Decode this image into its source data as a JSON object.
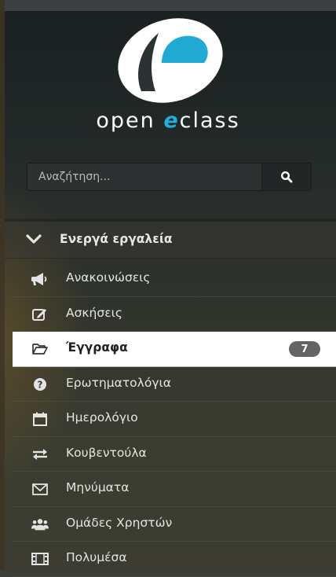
{
  "brand": {
    "open": "open ",
    "e": "e",
    "class": "class"
  },
  "search": {
    "placeholder": "Αναζήτηση..."
  },
  "section": {
    "title": "Ενεργά εργαλεία"
  },
  "menu": {
    "items": [
      {
        "label": "Ανακοινώσεις",
        "icon": "bullhorn-icon"
      },
      {
        "label": "Ασκήσεις",
        "icon": "edit-icon"
      },
      {
        "label": "Έγγραφα",
        "icon": "folder-open-icon",
        "badge": "7",
        "active": true
      },
      {
        "label": "Ερωτηματολόγια",
        "icon": "question-circle-icon"
      },
      {
        "label": "Ημερολόγιο",
        "icon": "calendar-icon"
      },
      {
        "label": "Κουβεντούλα",
        "icon": "exchange-icon"
      },
      {
        "label": "Μηνύματα",
        "icon": "envelope-icon"
      },
      {
        "label": "Ομάδες Χρηστών",
        "icon": "users-icon"
      },
      {
        "label": "Πολυμέσα",
        "icon": "film-icon"
      }
    ]
  },
  "colors": {
    "accent": "#1fb0d8",
    "badge": "#636363",
    "active_bg": "#ffffff"
  }
}
